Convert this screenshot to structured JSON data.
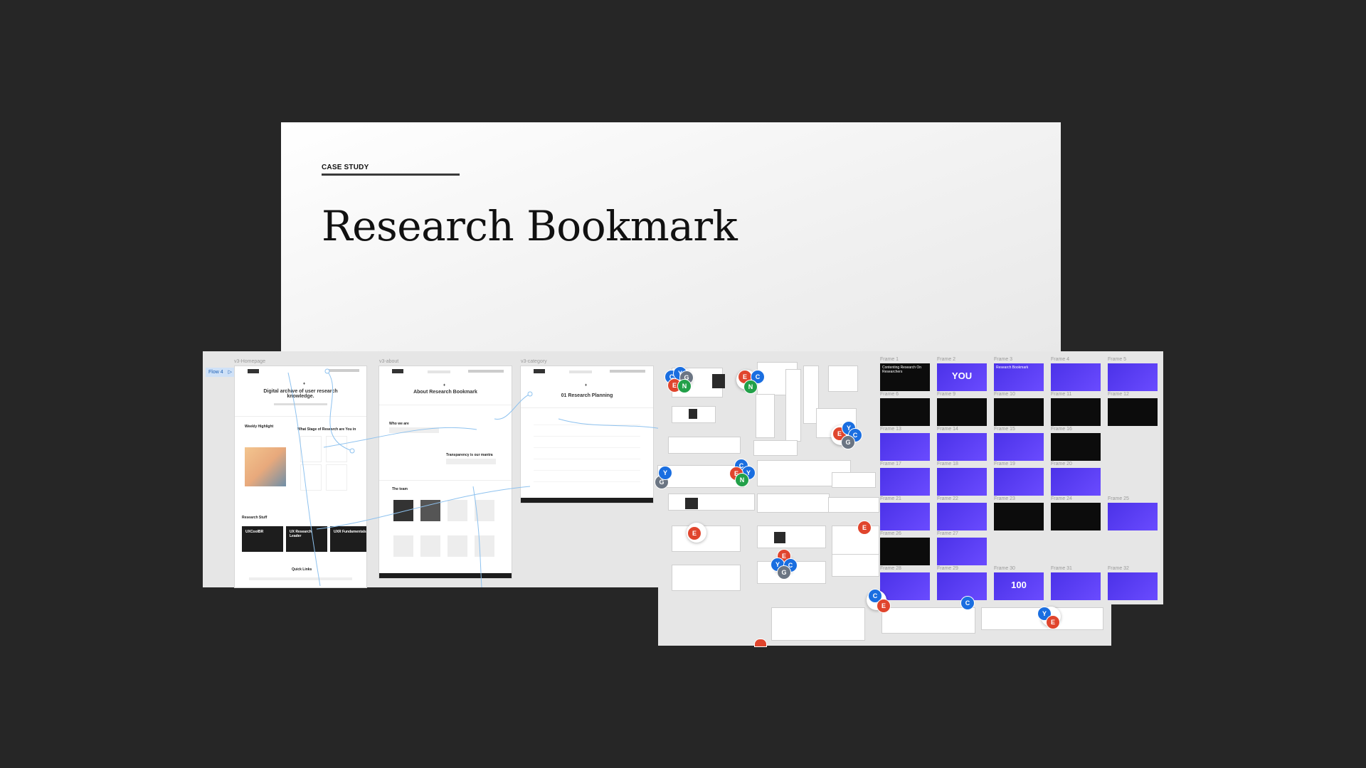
{
  "hero": {
    "eyebrow": "CASE STUDY",
    "title": "Research Bookmark"
  },
  "flow": {
    "label": "Flow 4"
  },
  "frames_left": [
    {
      "label": "v3-Homepage"
    },
    {
      "label": "v3-about"
    },
    {
      "label": "v3-category"
    }
  ],
  "homepage": {
    "headline": "Digital archive of user research knowledge.",
    "weekly": "Weekly Highlight",
    "stages": "What Stage of Research are You in",
    "research_stuff": "Research Stuff",
    "cards": [
      "UXCoolBR",
      "UX Research Leader",
      "UXR Fundamentals"
    ],
    "quick_links": "Quick Links"
  },
  "about": {
    "title": "About Research Bookmark",
    "who": "Who we are",
    "transparency": "Transparency is our mantra",
    "team": "The team"
  },
  "category": {
    "title": "01 Research Planning"
  },
  "frames_right": [
    {
      "label": "Frame 1",
      "style": "black",
      "text": "Contenting Research On Researchers"
    },
    {
      "label": "Frame 2",
      "style": "purple",
      "text": "YOU"
    },
    {
      "label": "Frame 3",
      "style": "purple",
      "text": "Research Bookmark"
    },
    {
      "label": "Frame 4",
      "style": "purple",
      "text": ""
    },
    {
      "label": "Frame 5",
      "style": "purple",
      "text": ""
    },
    {
      "label": "Frame 6",
      "style": "black",
      "text": ""
    },
    {
      "label": "Frame 9",
      "style": "black",
      "text": ""
    },
    {
      "label": "Frame 10",
      "style": "black",
      "text": ""
    },
    {
      "label": "Frame 11",
      "style": "black",
      "text": ""
    },
    {
      "label": "Frame 12",
      "style": "black",
      "text": ""
    },
    {
      "label": "Frame 13",
      "style": "purple",
      "text": ""
    },
    {
      "label": "Frame 14",
      "style": "purple",
      "text": ""
    },
    {
      "label": "Frame 15",
      "style": "purple",
      "text": ""
    },
    {
      "label": "Frame 16",
      "style": "black",
      "text": ""
    },
    {
      "label": "Frame 17",
      "style": "purple",
      "text": ""
    },
    {
      "label": "Frame 18",
      "style": "purple",
      "text": ""
    },
    {
      "label": "Frame 19",
      "style": "purple",
      "text": ""
    },
    {
      "label": "Frame 20",
      "style": "purple",
      "text": ""
    },
    {
      "label": "Frame 21",
      "style": "purple",
      "text": ""
    },
    {
      "label": "Frame 22",
      "style": "purple",
      "text": ""
    },
    {
      "label": "Frame 23",
      "style": "black",
      "text": ""
    },
    {
      "label": "Frame 24",
      "style": "black",
      "text": ""
    },
    {
      "label": "Frame 25",
      "style": "purple",
      "text": ""
    },
    {
      "label": "Frame 26",
      "style": "black",
      "text": ""
    },
    {
      "label": "Frame 27",
      "style": "purple",
      "text": ""
    },
    {
      "label": "Frame 28",
      "style": "purple",
      "text": ""
    },
    {
      "label": "Frame 29",
      "style": "purple",
      "text": ""
    },
    {
      "label": "Frame 30",
      "style": "purple",
      "text": "100"
    },
    {
      "label": "Frame 31",
      "style": "purple",
      "text": ""
    },
    {
      "label": "Frame 32",
      "style": "purple",
      "text": ""
    }
  ],
  "colors": {
    "accent_purple": "#5a3ff5",
    "background": "#262626",
    "canvas": "#e6e6e6"
  }
}
